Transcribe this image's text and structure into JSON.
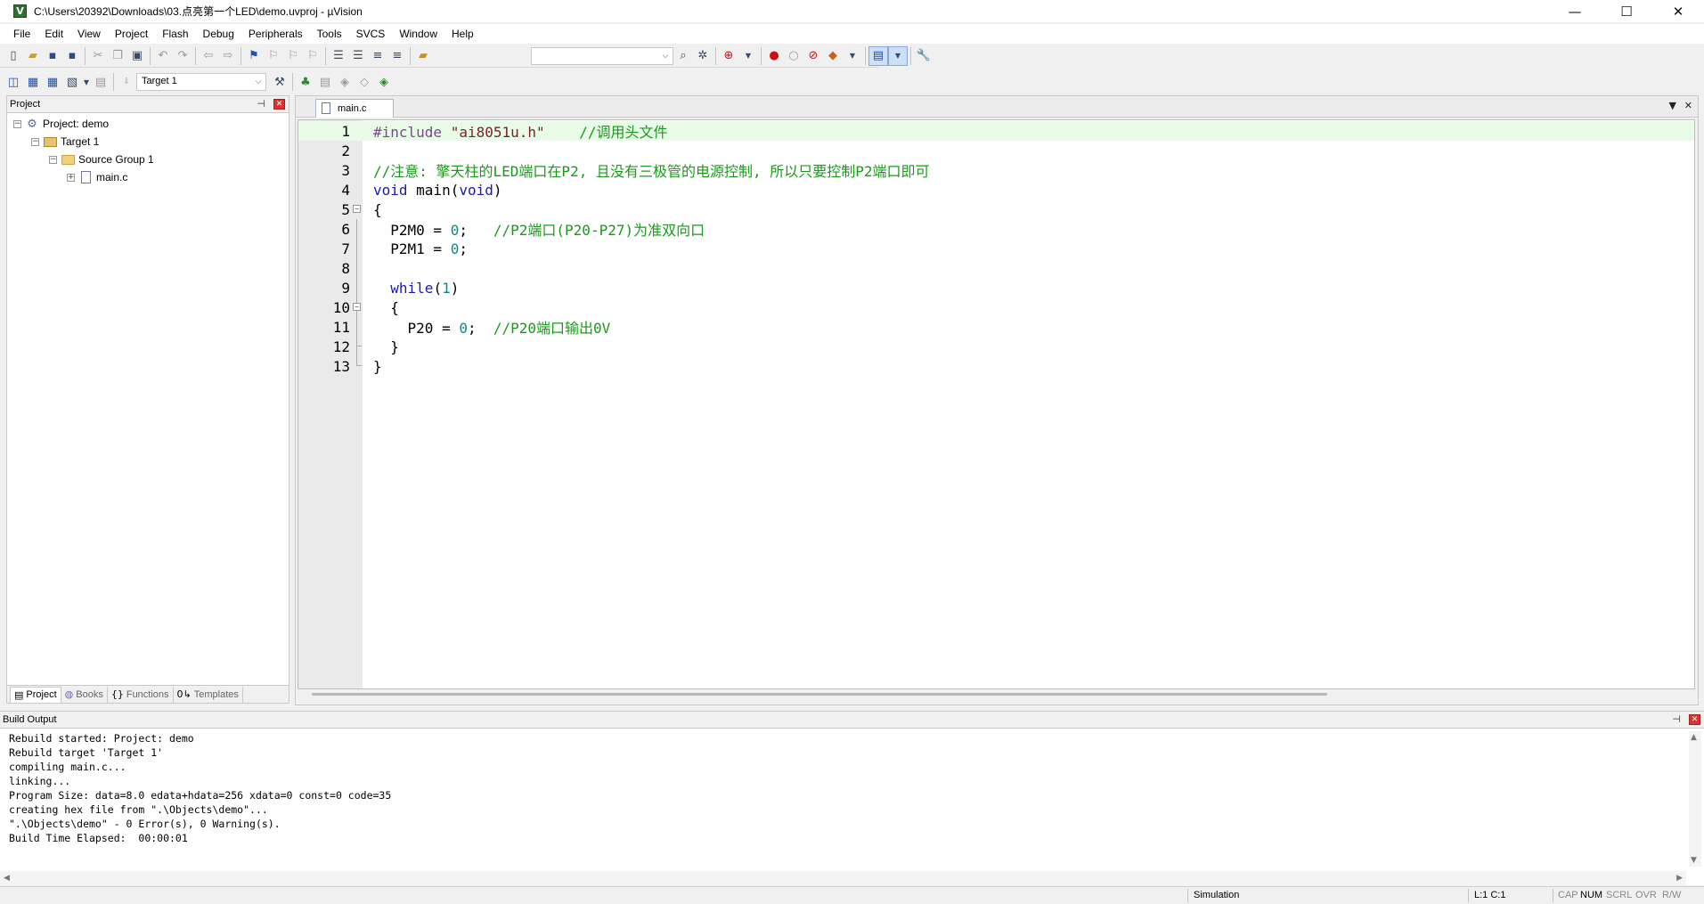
{
  "window": {
    "title": "C:\\Users\\20392\\Downloads\\03.点亮第一个LED\\demo.uvproj - µVision",
    "app_icon_letter": "V",
    "minimize": "—",
    "maximize": "☐",
    "close": "✕"
  },
  "menu": [
    "File",
    "Edit",
    "View",
    "Project",
    "Flash",
    "Debug",
    "Peripherals",
    "Tools",
    "SVCS",
    "Window",
    "Help"
  ],
  "toolbar": {
    "target_select": "Target 1",
    "combo_arrow": "⌵",
    "icons": {
      "new": "new-file-icon",
      "open": "open-folder-icon",
      "save": "save-icon",
      "save_all": "save-all-icon",
      "cut": "cut-icon",
      "copy": "copy-icon",
      "paste": "paste-icon",
      "undo": "undo-icon",
      "redo": "redo-icon",
      "nav_back": "navigate-back-icon",
      "nav_forward": "navigate-forward-icon",
      "bookmark": "bookmark-icon",
      "find": "find-icon",
      "debug": "start-debug-icon",
      "breakpoint": "breakpoint-icon",
      "build": "build-icon",
      "rebuild": "rebuild-icon",
      "options": "options-for-target-icon",
      "configure": "configure-icon"
    }
  },
  "project_panel": {
    "title": "Project",
    "pin": "⊣",
    "close": "✕",
    "tree": [
      {
        "label": "Project: demo",
        "level": 0,
        "expander": "−",
        "icon": "project-icon"
      },
      {
        "label": "Target 1",
        "level": 1,
        "expander": "−",
        "icon": "target-icon"
      },
      {
        "label": "Source Group 1",
        "level": 2,
        "expander": "−",
        "icon": "folder-icon"
      },
      {
        "label": "main.c",
        "level": 3,
        "expander": "+",
        "icon": "file-icon"
      }
    ],
    "tabs": [
      {
        "label": "Project",
        "icon": "▤",
        "active": true
      },
      {
        "label": "Books",
        "icon": "◍",
        "active": false
      },
      {
        "label": "Functions",
        "icon": "{}",
        "active": false
      },
      {
        "label": "Templates",
        "icon": "0↳",
        "active": false
      }
    ]
  },
  "editor": {
    "tab_label": "main.c",
    "tab_menu": "▼",
    "tab_close": "✕",
    "lines": [
      {
        "n": "1",
        "tokens": [
          {
            "t": "#include ",
            "c": "pre"
          },
          {
            "t": "\"ai8051u.h\"",
            "c": "str"
          },
          {
            "t": "    ",
            "c": ""
          },
          {
            "t": "//调用头文件",
            "c": "com"
          }
        ]
      },
      {
        "n": "2",
        "tokens": []
      },
      {
        "n": "3",
        "tokens": [
          {
            "t": "//注意: 擎天柱的LED端口在P2, 且没有三极管的电源控制, 所以只要控制P2端口即可",
            "c": "com"
          }
        ]
      },
      {
        "n": "4",
        "tokens": [
          {
            "t": "void",
            "c": "kw"
          },
          {
            "t": " main(",
            "c": ""
          },
          {
            "t": "void",
            "c": "kw"
          },
          {
            "t": ")",
            "c": ""
          }
        ]
      },
      {
        "n": "5",
        "tokens": [
          {
            "t": "{",
            "c": ""
          }
        ]
      },
      {
        "n": "6",
        "tokens": [
          {
            "t": "  P2M0 = ",
            "c": ""
          },
          {
            "t": "0",
            "c": "num"
          },
          {
            "t": ";   ",
            "c": ""
          },
          {
            "t": "//P2端口(P20-P27)为准双向口",
            "c": "com"
          }
        ]
      },
      {
        "n": "7",
        "tokens": [
          {
            "t": "  P2M1 = ",
            "c": ""
          },
          {
            "t": "0",
            "c": "num"
          },
          {
            "t": ";",
            "c": ""
          }
        ]
      },
      {
        "n": "8",
        "tokens": []
      },
      {
        "n": "9",
        "tokens": [
          {
            "t": "  ",
            "c": ""
          },
          {
            "t": "while",
            "c": "kw"
          },
          {
            "t": "(",
            "c": ""
          },
          {
            "t": "1",
            "c": "num"
          },
          {
            "t": ")",
            "c": ""
          }
        ]
      },
      {
        "n": "10",
        "tokens": [
          {
            "t": "  {",
            "c": ""
          }
        ]
      },
      {
        "n": "11",
        "tokens": [
          {
            "t": "    P20 = ",
            "c": ""
          },
          {
            "t": "0",
            "c": "num"
          },
          {
            "t": ";  ",
            "c": ""
          },
          {
            "t": "//P20端口输出0V",
            "c": "com"
          }
        ]
      },
      {
        "n": "12",
        "tokens": [
          {
            "t": "  }",
            "c": ""
          }
        ]
      },
      {
        "n": "13",
        "tokens": [
          {
            "t": "}",
            "c": ""
          }
        ]
      }
    ]
  },
  "build_output": {
    "title": "Build Output",
    "pin": "⊣",
    "close": "✕",
    "lines": [
      "Rebuild started: Project: demo",
      "Rebuild target 'Target 1'",
      "compiling main.c...",
      "linking...",
      "Program Size: data=8.0 edata+hdata=256 xdata=0 const=0 code=35",
      "creating hex file from \".\\Objects\\demo\"...",
      "\".\\Objects\\demo\" - 0 Error(s), 0 Warning(s).",
      "Build Time Elapsed:  00:00:01"
    ]
  },
  "statusbar": {
    "mode": "Simulation",
    "position": "L:1 C:1",
    "cap": "CAP",
    "num": "NUM",
    "scrl": "SCRL",
    "ovr": "OVR",
    "rw": "R/W"
  }
}
